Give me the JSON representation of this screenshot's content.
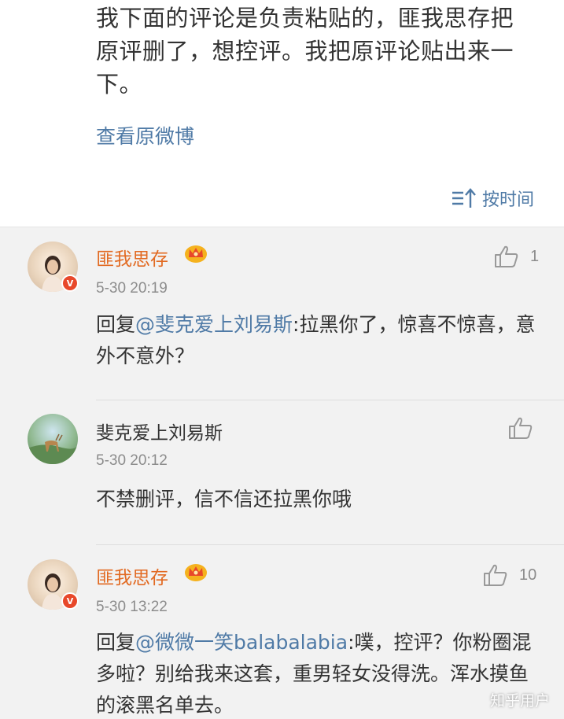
{
  "post": {
    "text": "我下面的评论是负责粘贴的，匪我思存把原评删了，想控评。我把原评论贴出来一下。",
    "view_original": "查看原微博"
  },
  "sort": {
    "label": "按时间"
  },
  "comments": [
    {
      "username": "匪我思存",
      "time": "5-30 20:19",
      "likes": "1",
      "reply_prefix": "回复",
      "mention": "@斐克爱上刘易斯",
      "text": ":拉黑你了，惊喜不惊喜，意外不意外？"
    },
    {
      "username": "斐克爱上刘易斯",
      "time": "5-30 20:12",
      "likes": "",
      "text": "不禁删评，信不信还拉黑你哦"
    },
    {
      "username": "匪我思存",
      "time": "5-30 13:22",
      "likes": "10",
      "reply_prefix": "回复",
      "mention": "@微微一笑balabalabia",
      "text": ":噗，控评？你粉圈混多啦？别给我来这套，重男轻女没得洗。浑水摸鱼的滚黑名单去。"
    }
  ],
  "watermark": "知乎用户",
  "colors": {
    "link": "#4f7aa6",
    "vip_name": "#e26a22",
    "muted": "#8c8c8c",
    "comments_bg": "#f2f2f2"
  }
}
